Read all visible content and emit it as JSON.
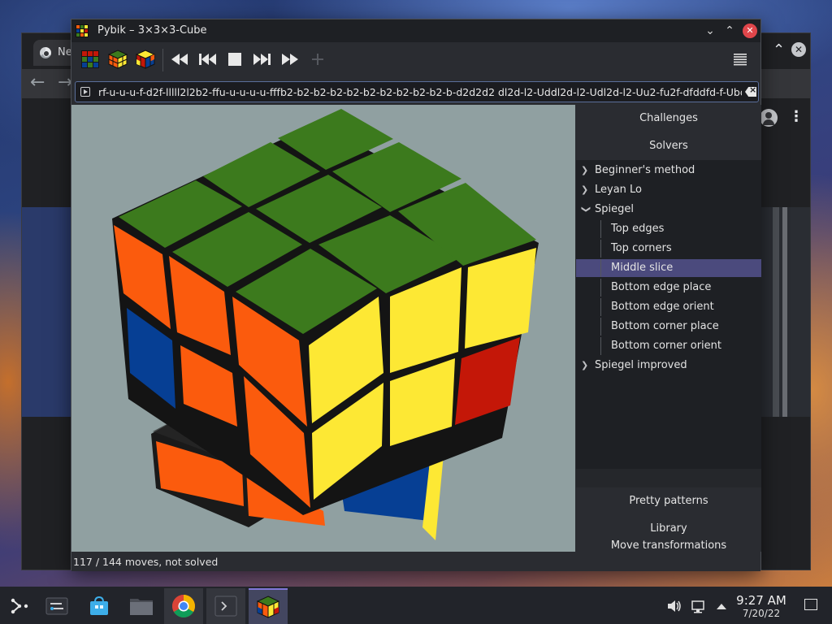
{
  "browser": {
    "tab_title": "Ne",
    "back_label": "←",
    "forward_label": "→",
    "minimize_label": "⌃",
    "close_label": "✕",
    "menu_label": "⋮"
  },
  "window": {
    "title": "Pybik – 3×3×3-Cube",
    "minimize_label": "⌄",
    "maximize_label": "⌃",
    "close_label": "✕"
  },
  "toolbar": {
    "buttons": [
      {
        "name": "new-solved-cube",
        "icon": "cube-solved-icon"
      },
      {
        "name": "random-cube",
        "icon": "cube-random-icon"
      },
      {
        "name": "reset-cube",
        "icon": "cube-mixed-icon"
      },
      {
        "name": "rewind",
        "icon": "rewind-icon"
      },
      {
        "name": "previous",
        "icon": "skip-back-icon"
      },
      {
        "name": "stop",
        "icon": "stop-icon"
      },
      {
        "name": "next",
        "icon": "skip-forward-icon"
      },
      {
        "name": "play",
        "icon": "fast-forward-icon"
      },
      {
        "name": "add-mark",
        "icon": "plus-icon"
      }
    ],
    "menu_icon": "hamburger-menu-icon"
  },
  "move_entry": {
    "value": "rf-u-u-u-f-d2f-lllll2l2b2-ffu-u-u-u-u-fffb2-b2-b2-b2-b2-b2-b2-b2-b2-b2-b-d2d2d2 dl2d-l2-Uddl2d-l2-Udl2d-l2-Uu2-fu2f-dfddfd-f-Ubdb"
  },
  "side_panel": {
    "challenges_label": "Challenges",
    "solvers_label": "Solvers",
    "tree": [
      {
        "label": "Beginner's method",
        "expanded": false,
        "level": 0
      },
      {
        "label": "Leyan Lo",
        "expanded": false,
        "level": 0
      },
      {
        "label": "Spiegel",
        "expanded": true,
        "level": 0
      },
      {
        "label": "Top edges",
        "level": 1
      },
      {
        "label": "Top corners",
        "level": 1
      },
      {
        "label": "Middle slice",
        "level": 1,
        "selected": true
      },
      {
        "label": "Bottom edge place",
        "level": 1
      },
      {
        "label": "Bottom edge orient",
        "level": 1
      },
      {
        "label": "Bottom corner place",
        "level": 1
      },
      {
        "label": "Bottom corner orient",
        "level": 1
      },
      {
        "label": "Spiegel improved",
        "expanded": false,
        "level": 0
      }
    ],
    "pretty_patterns_label": "Pretty patterns",
    "library_label": "Library",
    "move_transformations_label": "Move transformations"
  },
  "status": {
    "text": "117 / 144 moves, not solved"
  },
  "cube_colors": {
    "green": "#3c7a1d",
    "yellow": "#fde834",
    "orange": "#fb5b0d",
    "red": "#c41708",
    "blue": "#063f94",
    "body": "#1a1a1a",
    "background": "#90a0a1"
  },
  "taskbar": {
    "items": [
      "application-launcher-icon",
      "system-settings-icon",
      "discover-store-icon",
      "file-manager-icon",
      "chrome-icon",
      "terminal-icon",
      "pybik-icon"
    ],
    "clock_time": "9:27 AM",
    "clock_date": "7/20/22"
  },
  "colors": {
    "accent_selected": "#4b4a7d",
    "panel_bg": "#25272b",
    "close_button": "#e0464b"
  }
}
